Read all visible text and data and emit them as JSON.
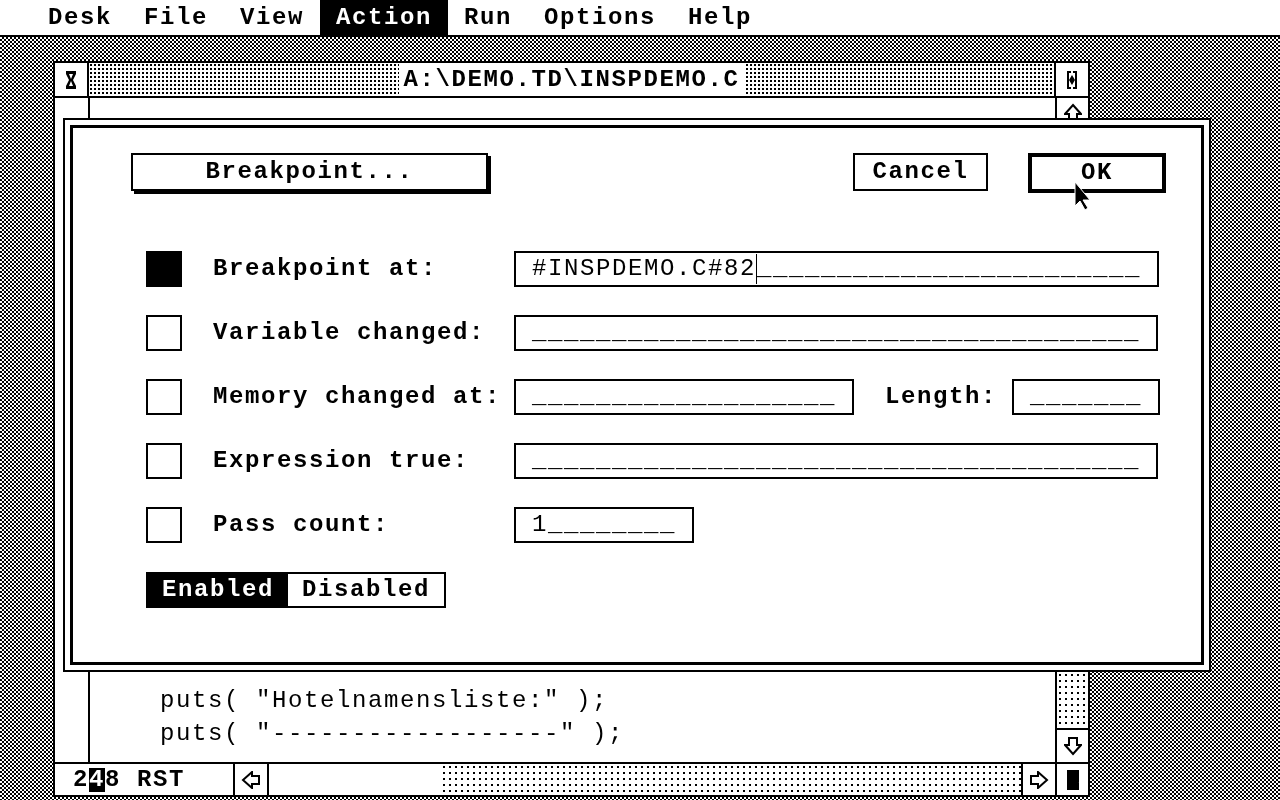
{
  "menu_bar": [
    {
      "label": "Desk",
      "selected": false
    },
    {
      "label": "File",
      "selected": false
    },
    {
      "label": "View",
      "selected": false
    },
    {
      "label": "Action",
      "selected": true
    },
    {
      "label": "Run",
      "selected": false
    },
    {
      "label": "Options",
      "selected": false
    },
    {
      "label": "Help",
      "selected": false
    }
  ],
  "window": {
    "title": "A:\\DEMO.TD\\INSPDEMO.C",
    "code_lines": [
      "puts( \"Hotelnamensliste:\" );",
      "puts( \"------------------\" );"
    ],
    "status_bar": {
      "before": "2",
      "cursor": "4",
      "after": "8 RST"
    }
  },
  "dialog": {
    "title_button": "Breakpoint...",
    "buttons": [
      {
        "label": "Cancel",
        "default": false
      },
      {
        "label": "OK",
        "default": true
      }
    ],
    "conditions": [
      {
        "label": "Breakpoint at:",
        "checked": true,
        "fields": [
          {
            "value": "#INSPDEMO.C#82",
            "blanks": "________________________",
            "focused": true
          }
        ]
      },
      {
        "label": "Variable changed:",
        "checked": false,
        "fields": [
          {
            "blanks": "______________________________________",
            "focused": false
          }
        ]
      },
      {
        "label": "Memory changed at:",
        "checked": false,
        "fields": [
          {
            "blanks": "___________________",
            "focused": false
          },
          {
            "label": "Length:",
            "blanks": "_______",
            "focused": false
          }
        ]
      },
      {
        "label": "Expression true:",
        "checked": false,
        "fields": [
          {
            "blanks": "______________________________________",
            "focused": false
          }
        ]
      },
      {
        "label": "Pass count:",
        "checked": false,
        "fields": [
          {
            "value": "1",
            "blanks": "________",
            "focused": false
          }
        ]
      }
    ],
    "mode": [
      {
        "label": "Enabled",
        "selected": true
      },
      {
        "label": "Disabled",
        "selected": false
      }
    ]
  }
}
